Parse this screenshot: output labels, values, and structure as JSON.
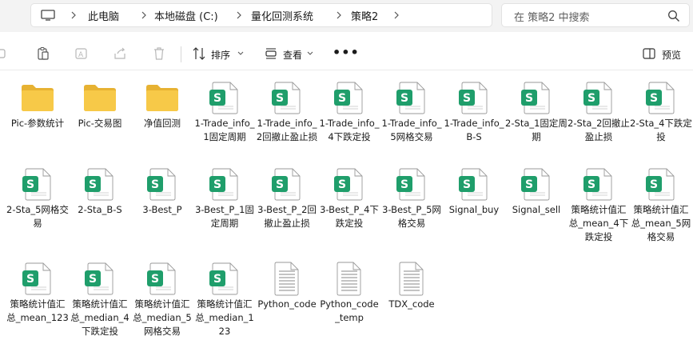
{
  "address": {
    "crumbs": [
      "此电脑",
      "本地磁盘 (C:)",
      "量化回测系统",
      "策略2"
    ]
  },
  "search": {
    "placeholder": "在 策略2 中搜索"
  },
  "toolbar": {
    "sort_label": "排序",
    "view_label": "查看",
    "more_label": "•••",
    "preview_label": "预览"
  },
  "files": [
    {
      "name": "Pic-参数统计",
      "type": "folder-pic"
    },
    {
      "name": "Pic-交易图",
      "type": "folder"
    },
    {
      "name": "净值回测",
      "type": "folder"
    },
    {
      "name": "1-Trade_info_1固定周期",
      "type": "sheet"
    },
    {
      "name": "1-Trade_info_2回撤止盈止损",
      "type": "sheet"
    },
    {
      "name": "1-Trade_info_4下跌定投",
      "type": "sheet"
    },
    {
      "name": "1-Trade_info_5网格交易",
      "type": "sheet"
    },
    {
      "name": "1-Trade_info_B-S",
      "type": "sheet"
    },
    {
      "name": "2-Sta_1固定周期",
      "type": "sheet"
    },
    {
      "name": "2-Sta_2回撤止盈止损",
      "type": "sheet"
    },
    {
      "name": "2-Sta_4下跌定投",
      "type": "sheet"
    },
    {
      "name": "2-Sta_5网格交易",
      "type": "sheet"
    },
    {
      "name": "2-Sta_B-S",
      "type": "sheet"
    },
    {
      "name": "3-Best_P",
      "type": "sheet"
    },
    {
      "name": "3-Best_P_1固定周期",
      "type": "sheet"
    },
    {
      "name": "3-Best_P_2回撤止盈止损",
      "type": "sheet"
    },
    {
      "name": "3-Best_P_4下跌定投",
      "type": "sheet"
    },
    {
      "name": "3-Best_P_5网格交易",
      "type": "sheet"
    },
    {
      "name": "Signal_buy",
      "type": "sheet"
    },
    {
      "name": "Signal_sell",
      "type": "sheet"
    },
    {
      "name": "策略统计值汇总_mean_4下跌定投",
      "type": "sheet"
    },
    {
      "name": "策略统计值汇总_mean_5网格交易",
      "type": "sheet"
    },
    {
      "name": "策略统计值汇总_mean_123",
      "type": "sheet"
    },
    {
      "name": "策略统计值汇总_median_4下跌定投",
      "type": "sheet"
    },
    {
      "name": "策略统计值汇总_median_5网格交易",
      "type": "sheet"
    },
    {
      "name": "策略统计值汇总_median_123",
      "type": "sheet"
    },
    {
      "name": "Python_code",
      "type": "text"
    },
    {
      "name": "Python_code_temp",
      "type": "text"
    },
    {
      "name": "TDX_code",
      "type": "text"
    }
  ],
  "colors": {
    "folder": "#f7c948",
    "sheet_green": "#1f9e6b",
    "accent": "#0067c0"
  }
}
